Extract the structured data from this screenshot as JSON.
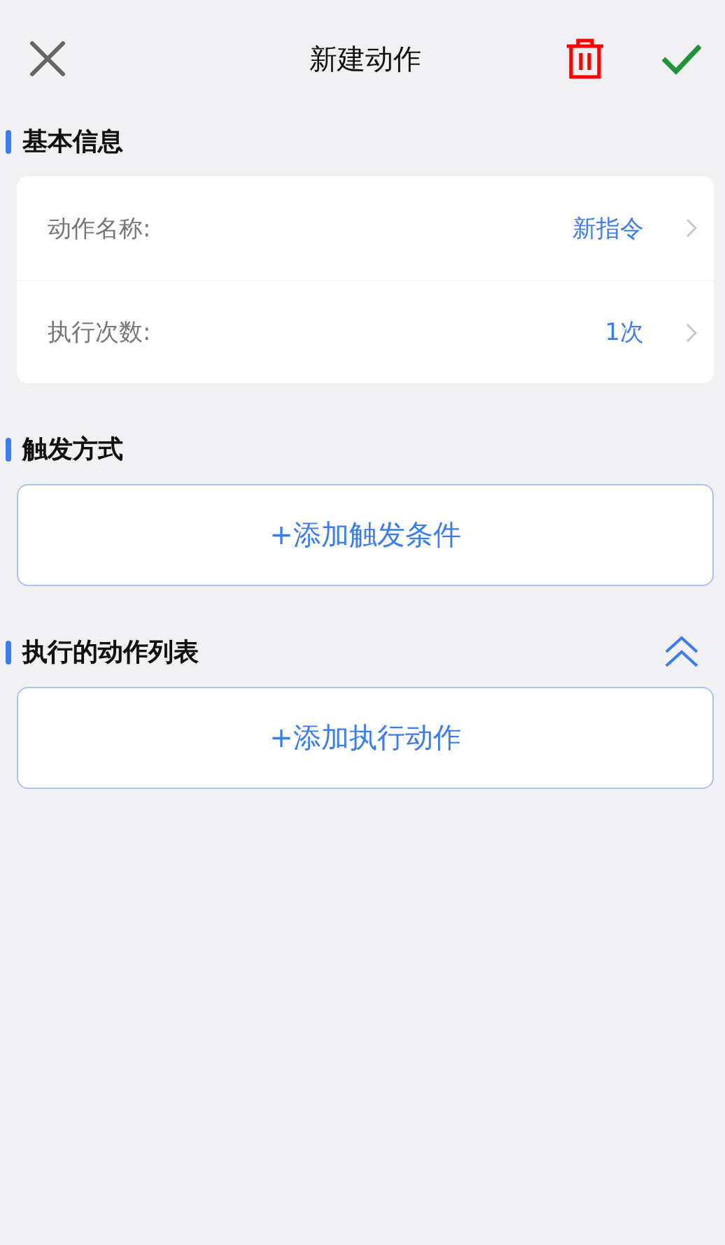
{
  "header": {
    "title": "新建动作"
  },
  "sections": [
    {
      "kind": "fields",
      "title": "基本信息",
      "rows": [
        {
          "label": "动作名称:",
          "value": "新指令"
        },
        {
          "label": "执行次数:",
          "value": "1次"
        }
      ]
    },
    {
      "kind": "add",
      "title": "触发方式",
      "button": "+添加触发条件"
    },
    {
      "kind": "add",
      "title": "执行的动作列表",
      "button": "+添加执行动作",
      "expanded": true
    }
  ]
}
